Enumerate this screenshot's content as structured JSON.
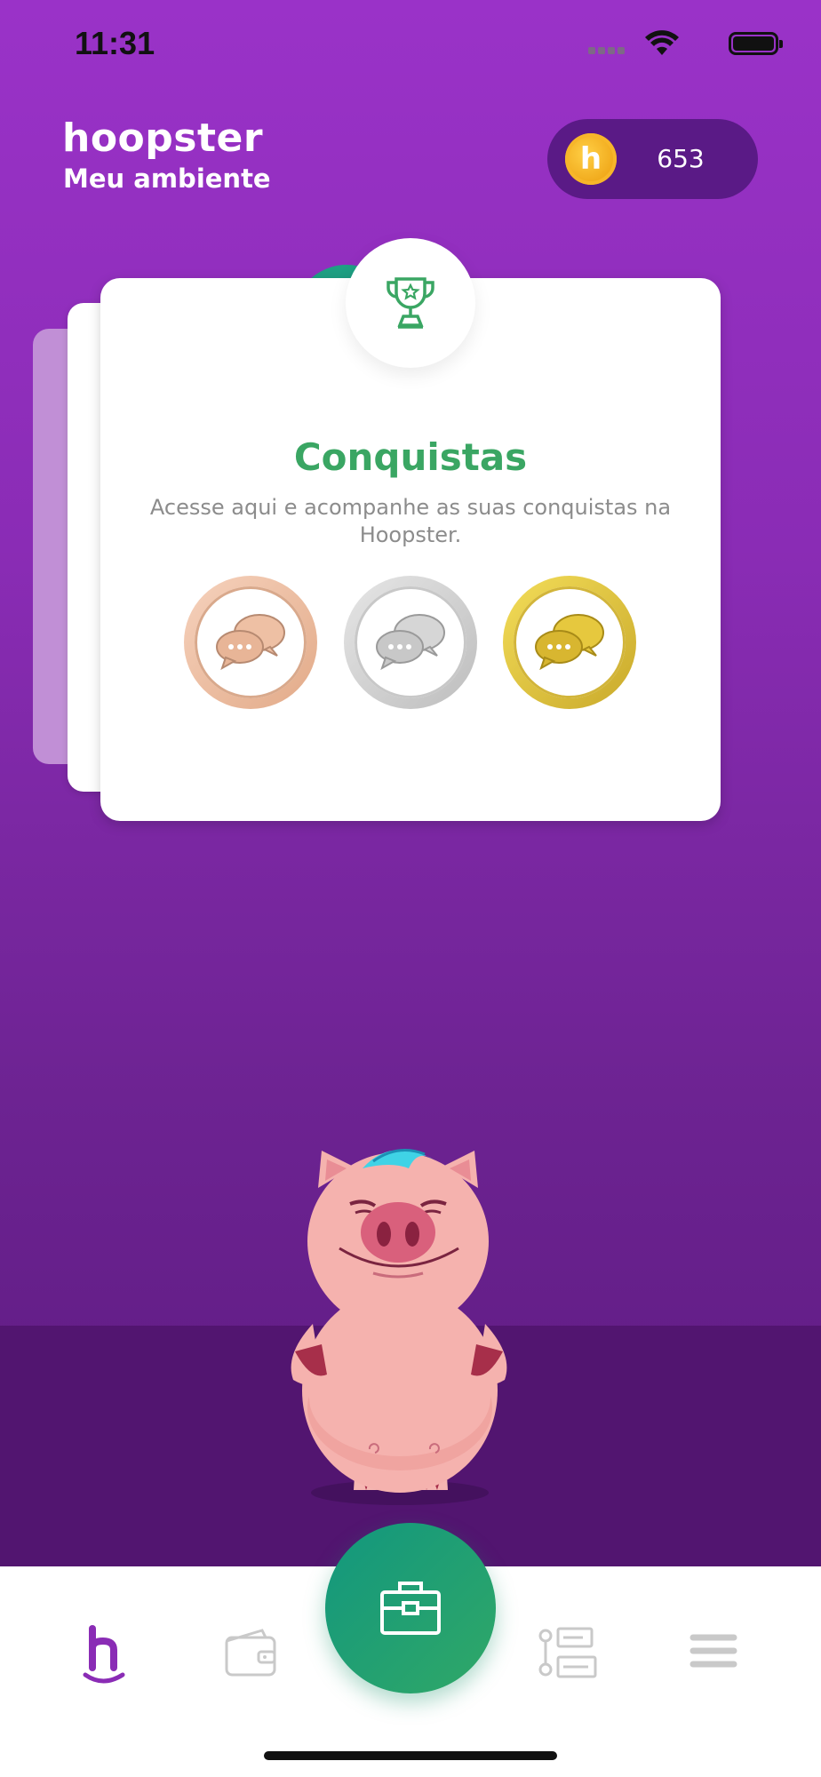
{
  "status_bar": {
    "time": "11:31"
  },
  "header": {
    "brand": "hoopster",
    "subtitle": "Meu ambiente",
    "coins": "653"
  },
  "card": {
    "title": "Conquistas",
    "description": "Acesse aqui e acompanhe as suas conquistas na Hoopster.",
    "badges": [
      {
        "icon": "chat-bubbles-icon",
        "tier": "bronze",
        "color": "#e2aa88"
      },
      {
        "icon": "chat-bubbles-icon",
        "tier": "silver",
        "color": "#bdbdbd"
      },
      {
        "icon": "chat-bubbles-icon",
        "tier": "gold",
        "color": "#d6b630"
      }
    ]
  },
  "nav": {
    "items": [
      "home-icon",
      "wallet-icon",
      "briefcase-icon",
      "flow-icon",
      "menu-icon"
    ],
    "active": "home-icon",
    "accent": "#8a2cb5",
    "fab_color": "#1fa07a"
  },
  "colors": {
    "background": "#8a2cb5",
    "title_green": "#3aa663"
  }
}
